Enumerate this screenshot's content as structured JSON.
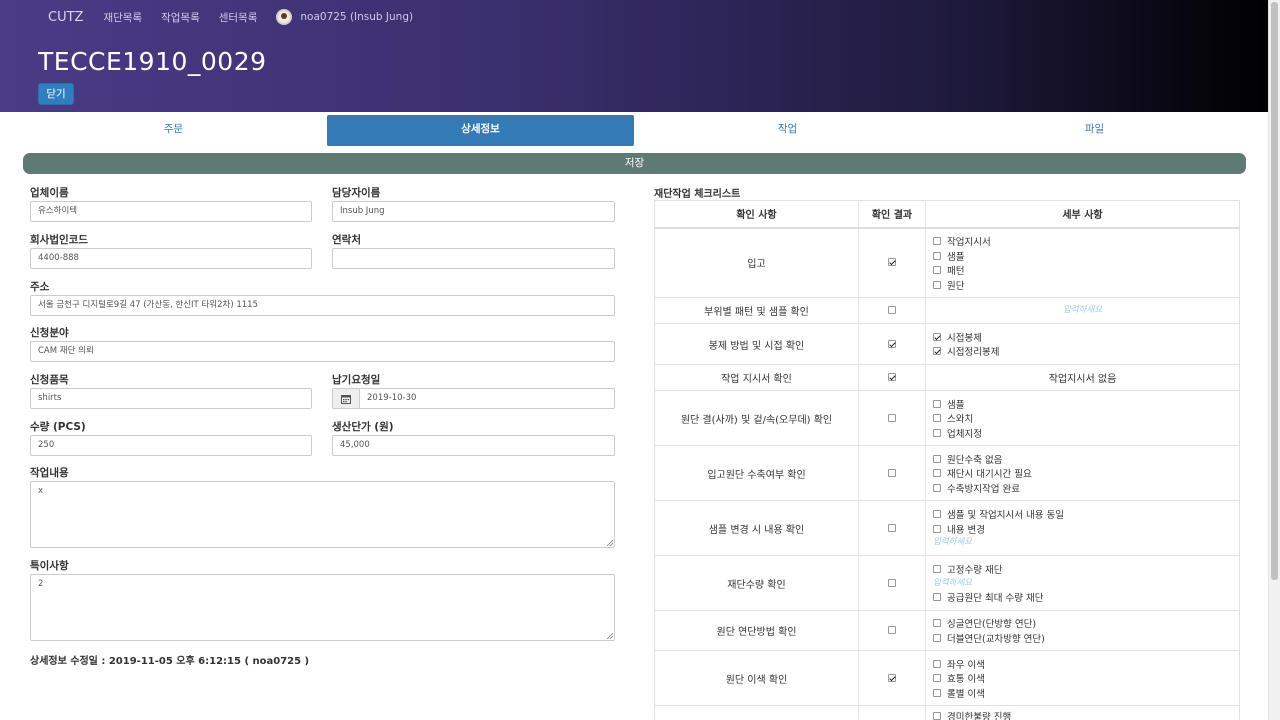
{
  "nav": {
    "brand": "CUTZ",
    "links": [
      "재단목록",
      "작업목록",
      "센터목록"
    ],
    "user": "noa0725 (Insub Jung)"
  },
  "page": {
    "title": "TECCE1910_0029",
    "close_label": "닫기"
  },
  "tabs": [
    "주문",
    "상세정보",
    "작업",
    "파일"
  ],
  "active_tab": "상세정보",
  "save_label": "저장",
  "form": {
    "company_name_label": "업체이름",
    "company_name": "유스하이텍",
    "manager_label": "담당자이름",
    "manager": "Insub Jung",
    "corp_code_label": "회사법인코드",
    "corp_code": "4400-888",
    "contact_label": "연락처",
    "contact": "",
    "address_label": "주소",
    "address": "서울 금천구 디지털로9길 47 (가산동, 한신IT 타워2차) 1115",
    "field_label": "신청분야",
    "field": "CAM 재단 의뢰",
    "item_label": "신청품목",
    "item": "shirts",
    "due_label": "납기요청일",
    "due": "2019-10-30",
    "qty_label": "수량 (PCS)",
    "qty": "250",
    "price_label": "생산단가 (원)",
    "price": "45,000",
    "work_label": "작업내용",
    "work": "x",
    "notes_label": "특이사항",
    "notes": "2",
    "modified": "상세정보 수정일 : 2019-11-05 오후 6:12:15 ( noa0725 )"
  },
  "checklist": {
    "title": "재단작업 체크리스트",
    "headers": [
      "확인 사항",
      "확인 결과",
      "세부 사항"
    ],
    "input_hint": "입력하세요",
    "rows": [
      {
        "item": "입고",
        "checked": true,
        "options": [
          {
            "label": "작업지시서",
            "checked": false
          },
          {
            "label": "샘플",
            "checked": false
          },
          {
            "label": "패턴",
            "checked": false
          },
          {
            "label": "원단",
            "checked": false
          }
        ]
      },
      {
        "item": "부위별 패턴 및 샘플 확인",
        "checked": false,
        "hint": "입력하세요"
      },
      {
        "item": "봉제 방법 및 시접 확인",
        "checked": true,
        "options": [
          {
            "label": "시접봉제",
            "checked": true
          },
          {
            "label": "시접정리봉제",
            "checked": true
          }
        ]
      },
      {
        "item": "작업 지시서 확인",
        "checked": true,
        "text": "작업지시서 없음"
      },
      {
        "item": "원단 결(사까) 및 겉/속(오무데) 확인",
        "checked": false,
        "options": [
          {
            "label": "샘플",
            "checked": false
          },
          {
            "label": "스와치",
            "checked": false
          },
          {
            "label": "업체지정",
            "checked": false
          }
        ]
      },
      {
        "item": "입고원단 수축여부 확인",
        "checked": false,
        "options": [
          {
            "label": "원단수축 없음",
            "checked": false
          },
          {
            "label": "재단시 대기시간 필요",
            "checked": false
          },
          {
            "label": "수축방지작업 완료",
            "checked": false
          }
        ]
      },
      {
        "item": "샘플 변경 시 내용 확인",
        "checked": false,
        "options": [
          {
            "label": "샘플 및 작업지시서 내용 동일",
            "checked": false
          },
          {
            "label": "내용 변경",
            "checked": false
          }
        ],
        "hint_after": "입력하세요"
      },
      {
        "item": "재단수량 확인",
        "checked": false,
        "options": [
          {
            "label": "고정수량 재단",
            "checked": false
          }
        ],
        "hint_mid": "입력하세요",
        "options2": [
          {
            "label": "공급원단 최대 수량 재단",
            "checked": false
          }
        ]
      },
      {
        "item": "원단 연단방법 확인",
        "checked": false,
        "options": [
          {
            "label": "싱글연단(단방향 연단)",
            "checked": false
          },
          {
            "label": "더블연단(교차방향 연단)",
            "checked": false
          }
        ]
      },
      {
        "item": "원단 이색 확인",
        "checked": true,
        "options": [
          {
            "label": "좌우 이색",
            "checked": false
          },
          {
            "label": "효통 이색",
            "checked": false
          },
          {
            "label": "롤별 이색",
            "checked": false
          }
        ]
      },
      {
        "item": "",
        "checked": false,
        "options": [
          {
            "label": "경미한불량 진행",
            "checked": false
          }
        ]
      }
    ]
  }
}
